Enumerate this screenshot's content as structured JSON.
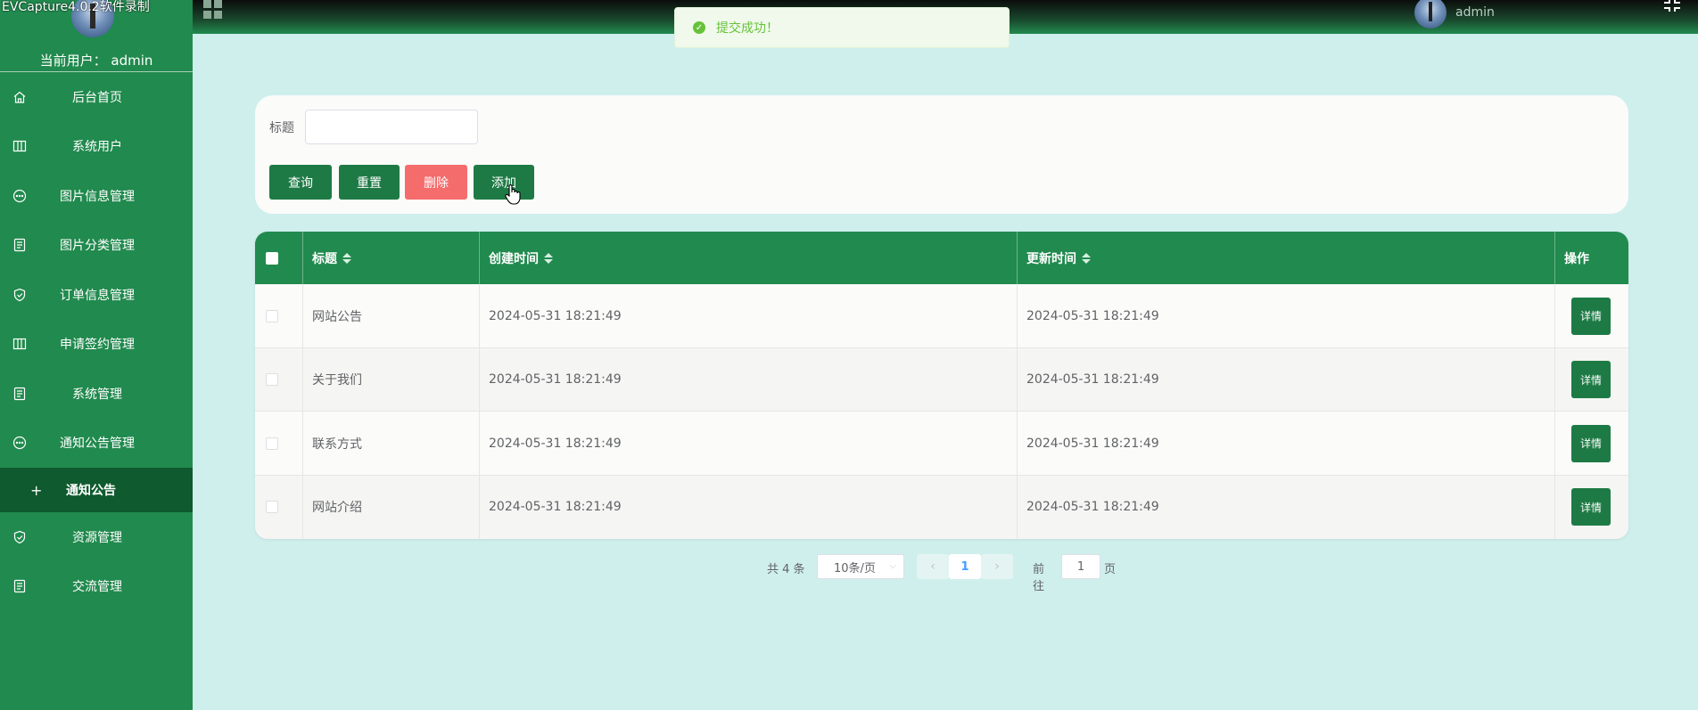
{
  "watermark": "EVCapture4.0.2软件录制",
  "sidebar": {
    "current_user": "当前用户： admin",
    "items": [
      {
        "label": "后台首页",
        "icon": "home-icon"
      },
      {
        "label": "系统用户",
        "icon": "columns-icon"
      },
      {
        "label": "图片信息管理",
        "icon": "chat-dots-icon"
      },
      {
        "label": "图片分类管理",
        "icon": "document-icon"
      },
      {
        "label": "订单信息管理",
        "icon": "shield-check-icon"
      },
      {
        "label": "申请签约管理",
        "icon": "columns-icon"
      },
      {
        "label": "系统管理",
        "icon": "document-icon"
      },
      {
        "label": "通知公告管理",
        "icon": "chat-dots-icon"
      },
      {
        "label": "资源管理",
        "icon": "shield-check-icon"
      },
      {
        "label": "交流管理",
        "icon": "document-icon"
      }
    ],
    "active_sub": "通知公告"
  },
  "header": {
    "username": "admin"
  },
  "toast": {
    "message": "提交成功！"
  },
  "search": {
    "title_label": "标题",
    "title_value": "",
    "query_label": "查询",
    "reset_label": "重置",
    "delete_label": "删除",
    "add_label": "添加"
  },
  "table": {
    "columns": [
      "标题",
      "创建时间",
      "更新时间",
      "操作"
    ],
    "rows": [
      {
        "title": "网站公告",
        "created": "2024-05-31 18:21:49",
        "updated": "2024-05-31 18:21:49",
        "action": "详情"
      },
      {
        "title": "关于我们",
        "created": "2024-05-31 18:21:49",
        "updated": "2024-05-31 18:21:49",
        "action": "详情"
      },
      {
        "title": "联系方式",
        "created": "2024-05-31 18:21:49",
        "updated": "2024-05-31 18:21:49",
        "action": "详情"
      },
      {
        "title": "网站介绍",
        "created": "2024-05-31 18:21:49",
        "updated": "2024-05-31 18:21:49",
        "action": "详情"
      }
    ]
  },
  "pagination": {
    "total": "共 4 条",
    "page_size": "10条/页",
    "current_page": "1",
    "goto_label": "前往",
    "goto_value": "1",
    "page_unit": "页"
  },
  "colors": {
    "primary": "#218a4e",
    "danger": "#f56c6c",
    "background": "#cfefed",
    "active_sub": "#0f5a2e"
  }
}
